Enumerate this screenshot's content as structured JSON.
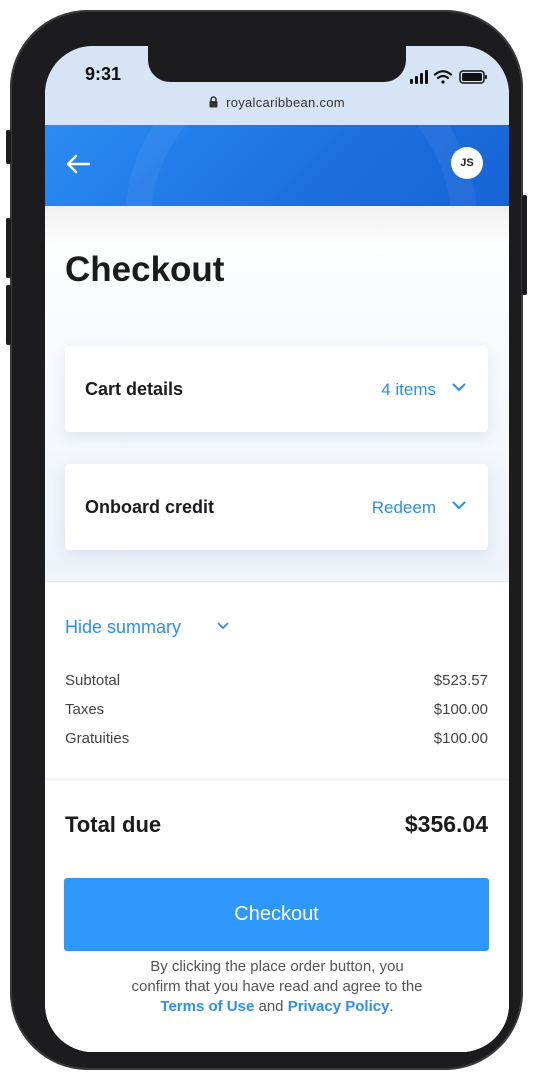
{
  "status_bar": {
    "time": "9:31",
    "url": "royalcaribbean.com"
  },
  "header": {
    "back_icon": "arrow-left-icon",
    "avatar_initials": "JS"
  },
  "page": {
    "title": "Checkout"
  },
  "cards": {
    "cart": {
      "label": "Cart details",
      "value": "4 items",
      "icon": "chevron-down-icon"
    },
    "credit": {
      "label": "Onboard credit",
      "value": "Redeem",
      "icon": "chevron-down-icon"
    }
  },
  "summary": {
    "toggle_label": "Hide summary",
    "rows": [
      {
        "label": "Subtotal",
        "value": "$523.57"
      },
      {
        "label": "Taxes",
        "value": "$100.00"
      },
      {
        "label": "Gratuities",
        "value": "$100.00"
      }
    ]
  },
  "total": {
    "label": "Total due",
    "value": "$356.04"
  },
  "checkout_button": {
    "label": "Checkout"
  },
  "legal": {
    "line1": "By clicking the place order button, you",
    "line2": "confirm that you have read and agree to the",
    "terms_link": "Terms of Use",
    "and": "and",
    "privacy_link": "Privacy Policy",
    "end": "."
  },
  "colors": {
    "accent": "#2d8ff0",
    "button": "#2d97fb",
    "header": "#1d6fe0"
  }
}
